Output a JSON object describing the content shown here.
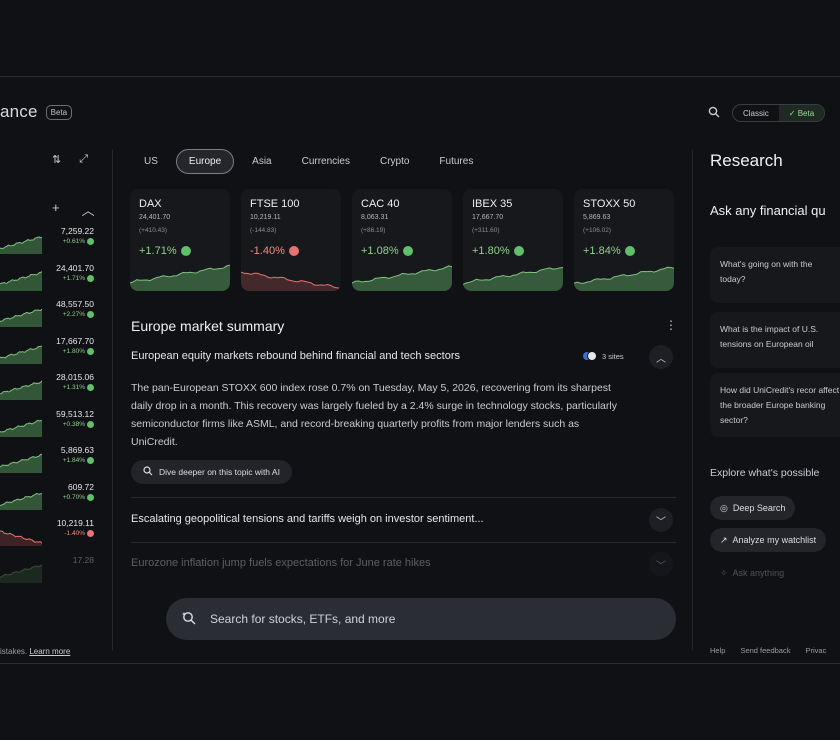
{
  "header": {
    "brand_partial": "ance",
    "beta_badge": "Beta",
    "toggle": {
      "classic": "Classic",
      "beta": "✓ Beta"
    }
  },
  "left_rail": {
    "rows": [
      {
        "value": "7,259.22",
        "change": "+0.61%",
        "positive": true
      },
      {
        "value": "24,401.70",
        "change": "+1.71%",
        "positive": true
      },
      {
        "value": "48,557.50",
        "change": "+2.27%",
        "positive": true
      },
      {
        "value": "17,667.70",
        "change": "+1.80%",
        "positive": true
      },
      {
        "value": "28,015.06",
        "change": "+1.31%",
        "positive": true
      },
      {
        "value": "59,513.12",
        "change": "+0.38%",
        "positive": true
      },
      {
        "value": "5,869.63",
        "change": "+1.84%",
        "positive": true
      },
      {
        "value": "609.72",
        "change": "+0.70%",
        "positive": true
      },
      {
        "value": "10,219.11",
        "change": "-1.40%",
        "positive": false
      },
      {
        "value": "17.28",
        "change": "",
        "positive": true
      }
    ],
    "footer_text": "istakes.",
    "footer_link": "Learn more"
  },
  "tabs": [
    "US",
    "Europe",
    "Asia",
    "Currencies",
    "Crypto",
    "Futures"
  ],
  "active_tab": 1,
  "indices": [
    {
      "name": "DAX",
      "price": "24,401.70",
      "abs": "(+410.43)",
      "pct": "+1.71%",
      "positive": true
    },
    {
      "name": "FTSE 100",
      "price": "10,219.11",
      "abs": "(-144.83)",
      "pct": "-1.40%",
      "positive": false
    },
    {
      "name": "CAC 40",
      "price": "8,063.31",
      "abs": "(+86.19)",
      "pct": "+1.08%",
      "positive": true
    },
    {
      "name": "IBEX 35",
      "price": "17,667.70",
      "abs": "(+311.60)",
      "pct": "+1.80%",
      "positive": true
    },
    {
      "name": "STOXX 50",
      "price": "5,869.63",
      "abs": "(+106.02)",
      "pct": "+1.84%",
      "positive": true
    }
  ],
  "summary": {
    "title": "Europe market summary",
    "headline": "European equity markets rebound behind financial and tech sectors",
    "sites": "3 sites",
    "body": "The pan-European STOXX 600 index rose 0.7% on Tuesday, May 5, 2026, recovering from its sharpest daily drop in a month. This recovery was largely fueled by a 2.4% surge in technology stocks, particularly semiconductor firms like ASML, and record-breaking quarterly profits from major lenders such as UniCredit.",
    "dive_button": "Dive deeper on this topic with AI",
    "headline2": "Escalating geopolitical tensions and tariffs weigh on investor sentiment...",
    "headline3": "Eurozone inflation jump fuels expectations for June rate hikes"
  },
  "search": {
    "placeholder": "Search for stocks, ETFs, and more"
  },
  "research": {
    "title": "Research",
    "ask_title": "Ask any financial qu",
    "questions": [
      "What's going on with the today?",
      "What is the impact of U.S. tensions on European oil",
      "How did UniCredit's recor affect the broader Europe banking sector?"
    ],
    "explore": "Explore what's possible",
    "chips": [
      "Deep Search",
      "Analyze my watchlist",
      "Ask anything"
    ]
  },
  "footer_right": [
    "Help",
    "Send feedback",
    "Privac"
  ],
  "colors": {
    "background": "#101115",
    "positive": "#8fd18f",
    "negative": "#f28b82",
    "card": "#17181c"
  }
}
